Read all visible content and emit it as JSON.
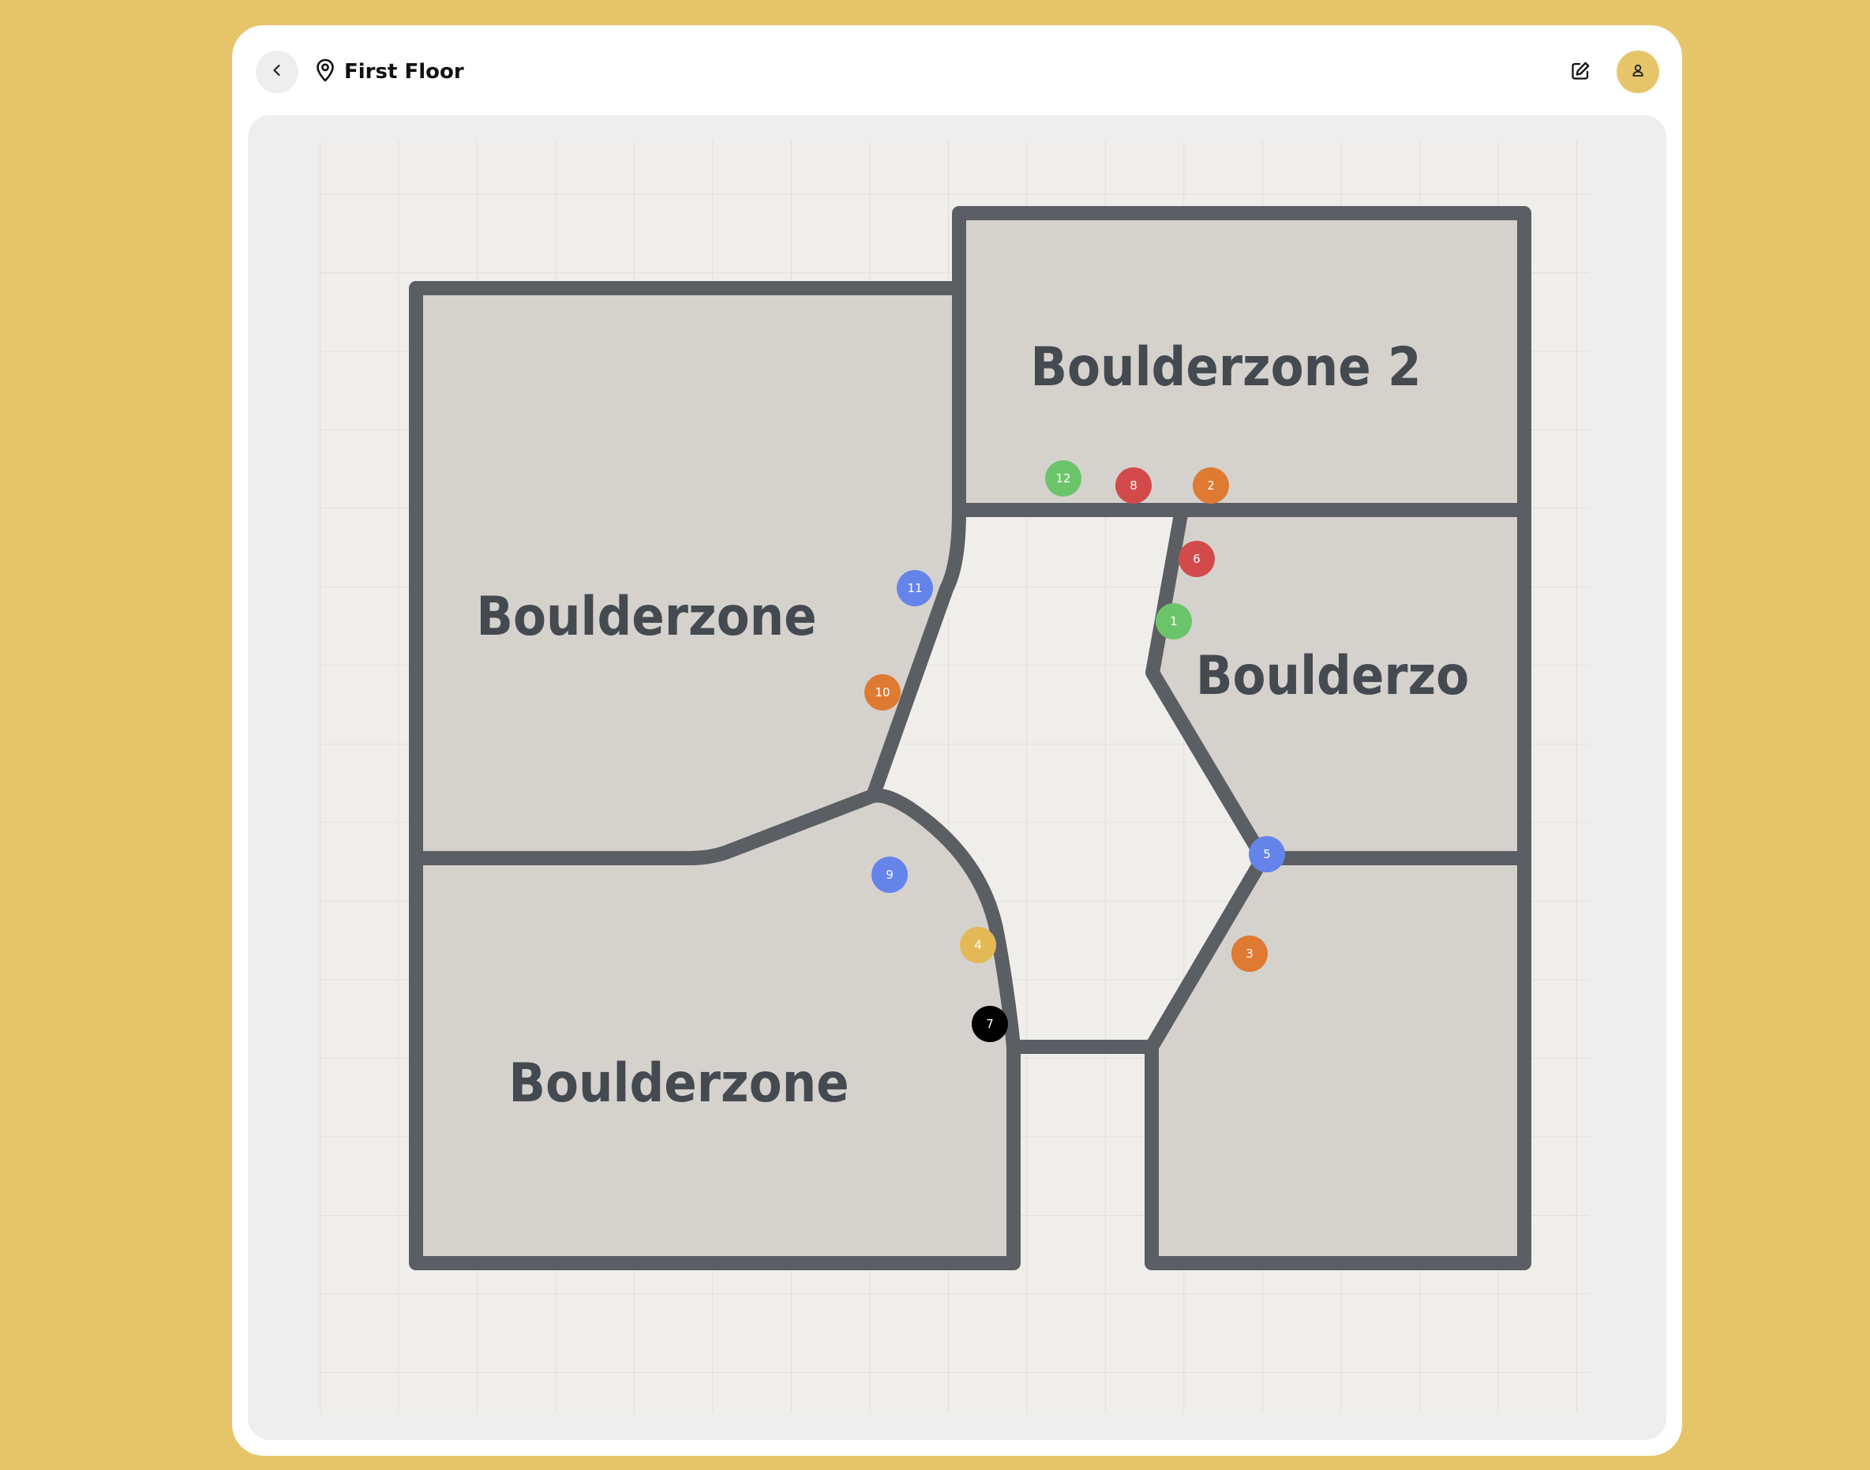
{
  "header": {
    "title": "First Floor"
  },
  "icons": {
    "back": "chevron-left-icon",
    "location": "map-pin-icon",
    "edit": "edit-icon",
    "avatar": "user-icon"
  },
  "colors": {
    "background": "#E6C56A",
    "wall": "#5B5E63",
    "zone_fill": "#D5D2CE",
    "floor": "#F0EEEB",
    "marker_green": "#6CC46A",
    "marker_red": "#D34A4A",
    "marker_orange": "#DE7A32",
    "marker_blue": "#6584EA",
    "marker_yellow": "#E3B957",
    "marker_black": "#000000"
  },
  "zones": [
    {
      "id": "zone-top-right",
      "label": "Boulderzone 2"
    },
    {
      "id": "zone-top-left",
      "label": "Boulderzone"
    },
    {
      "id": "zone-mid-right",
      "label": "Boulderzo"
    },
    {
      "id": "zone-bottom-left",
      "label": "Boulderzone"
    },
    {
      "id": "zone-bottom-right",
      "label": ""
    }
  ],
  "markers": [
    {
      "label": "1",
      "color": "#6CC46A"
    },
    {
      "label": "2",
      "color": "#DE7A32"
    },
    {
      "label": "3",
      "color": "#DE7A32"
    },
    {
      "label": "4",
      "color": "#E3B957"
    },
    {
      "label": "5",
      "color": "#6584EA"
    },
    {
      "label": "6",
      "color": "#D34A4A"
    },
    {
      "label": "7",
      "color": "#000000"
    },
    {
      "label": "8",
      "color": "#D34A4A"
    },
    {
      "label": "9",
      "color": "#6584EA"
    },
    {
      "label": "10",
      "color": "#DE7A32"
    },
    {
      "label": "11",
      "color": "#6584EA"
    },
    {
      "label": "12",
      "color": "#6CC46A"
    }
  ]
}
